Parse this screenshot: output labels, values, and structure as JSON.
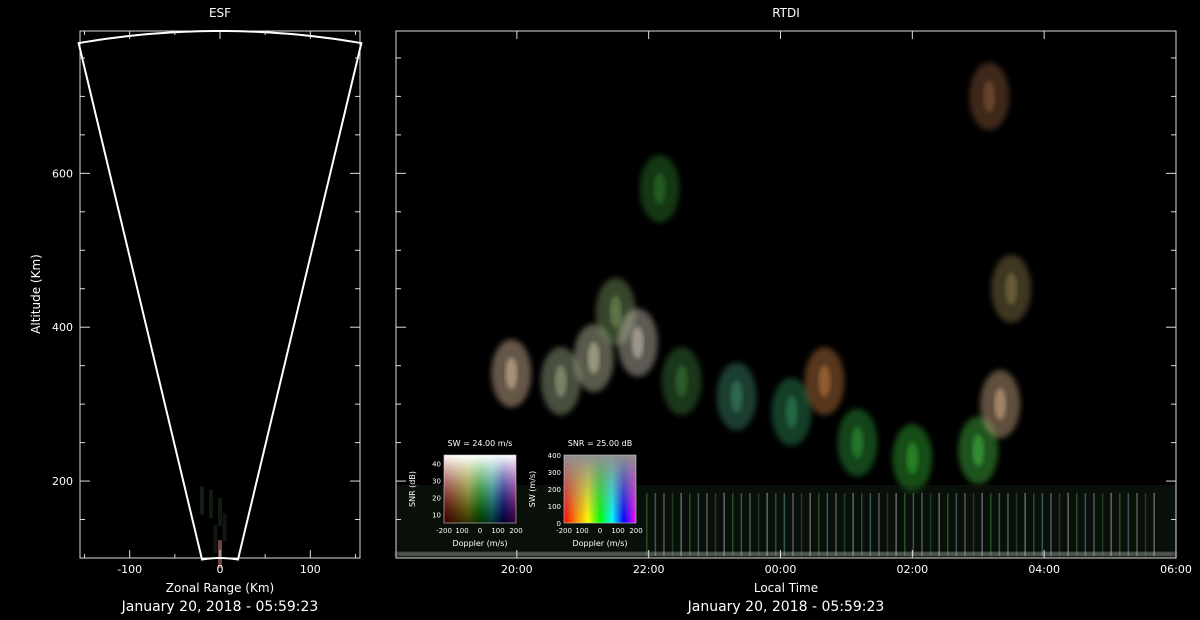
{
  "chart_data": [
    {
      "type": "scatter",
      "title": "ESF",
      "xlabel": "Zonal Range (Km)",
      "ylabel": "Altitude (Km)",
      "footer": "January 20, 2018 - 05:59:23",
      "xlim": [
        -155,
        155
      ],
      "ylim": [
        100,
        785
      ],
      "xticks": [
        -100,
        0,
        100
      ],
      "xtick_labels": [
        "-100",
        "0",
        "100"
      ],
      "yticks": [
        200,
        400,
        600
      ],
      "ytick_labels": [
        "200",
        "400",
        "600"
      ],
      "fan_half_angle_deg": 11.5,
      "fan_max_range_km": 785,
      "fan_min_range_km": 100,
      "echoes": [
        {
          "x": -20,
          "y": 175,
          "v": 0.35
        },
        {
          "x": -10,
          "y": 170,
          "v": 0.3
        },
        {
          "x": 0,
          "y": 160,
          "v": 0.3
        },
        {
          "x": 5,
          "y": 140,
          "v": 0.25
        },
        {
          "x": -5,
          "y": 125,
          "v": 0.25
        },
        {
          "x": 0,
          "y": 105,
          "v": 0.6
        }
      ]
    },
    {
      "type": "heatmap",
      "title": "RTDI",
      "xlabel": "Local Time",
      "ylabel": "",
      "footer": "January 20, 2018 - 05:59:23",
      "xlim": [
        "18:10",
        "06:00"
      ],
      "ylim": [
        100,
        785
      ],
      "xticks": [
        "20:00",
        "22:00",
        "00:00",
        "02:00",
        "04:00",
        "06:00"
      ],
      "grid": false,
      "features": [
        {
          "t": "19:55",
          "alt": 340,
          "c": "#e0c0a0"
        },
        {
          "t": "20:40",
          "alt": 330,
          "c": "#9fb08a"
        },
        {
          "t": "21:10",
          "alt": 360,
          "c": "#c8c8a8"
        },
        {
          "t": "21:30",
          "alt": 420,
          "c": "#7a9a60"
        },
        {
          "t": "21:50",
          "alt": 380,
          "c": "#d0c8b8"
        },
        {
          "t": "22:30",
          "alt": 330,
          "c": "#3a7a3a"
        },
        {
          "t": "23:20",
          "alt": 310,
          "c": "#3c8a6a"
        },
        {
          "t": "00:10",
          "alt": 290,
          "c": "#2f8a5a"
        },
        {
          "t": "00:40",
          "alt": 330,
          "c": "#c07a40"
        },
        {
          "t": "01:10",
          "alt": 250,
          "c": "#2f9a3a"
        },
        {
          "t": "02:00",
          "alt": 230,
          "c": "#33aa33"
        },
        {
          "t": "03:00",
          "alt": 240,
          "c": "#44bb44"
        },
        {
          "t": "03:20",
          "alt": 300,
          "c": "#d6b08a"
        },
        {
          "t": "03:30",
          "alt": 450,
          "c": "#8a7a4a"
        },
        {
          "t": "03:10",
          "alt": 700,
          "c": "#8a5a3a"
        },
        {
          "t": "22:10",
          "alt": 580,
          "c": "#2f7a2f"
        }
      ],
      "legends": [
        {
          "title": "SW = 24.00 m/s",
          "xlabel": "Doppler (m/s)",
          "ylabel": "SNR (dB)",
          "xtick_labels": [
            "-200",
            "100",
            "0",
            "100",
            "200"
          ],
          "ytick_labels": [
            "10",
            "20",
            "30",
            "40"
          ]
        },
        {
          "title": "SNR = 25.00 dB",
          "xlabel": "Doppler (m/s)",
          "ylabel": "SW (m/s)",
          "xtick_labels": [
            "-200",
            "100",
            "0",
            "100",
            "200"
          ],
          "ytick_labels": [
            "0",
            "100",
            "200",
            "300",
            "400"
          ]
        }
      ]
    }
  ]
}
